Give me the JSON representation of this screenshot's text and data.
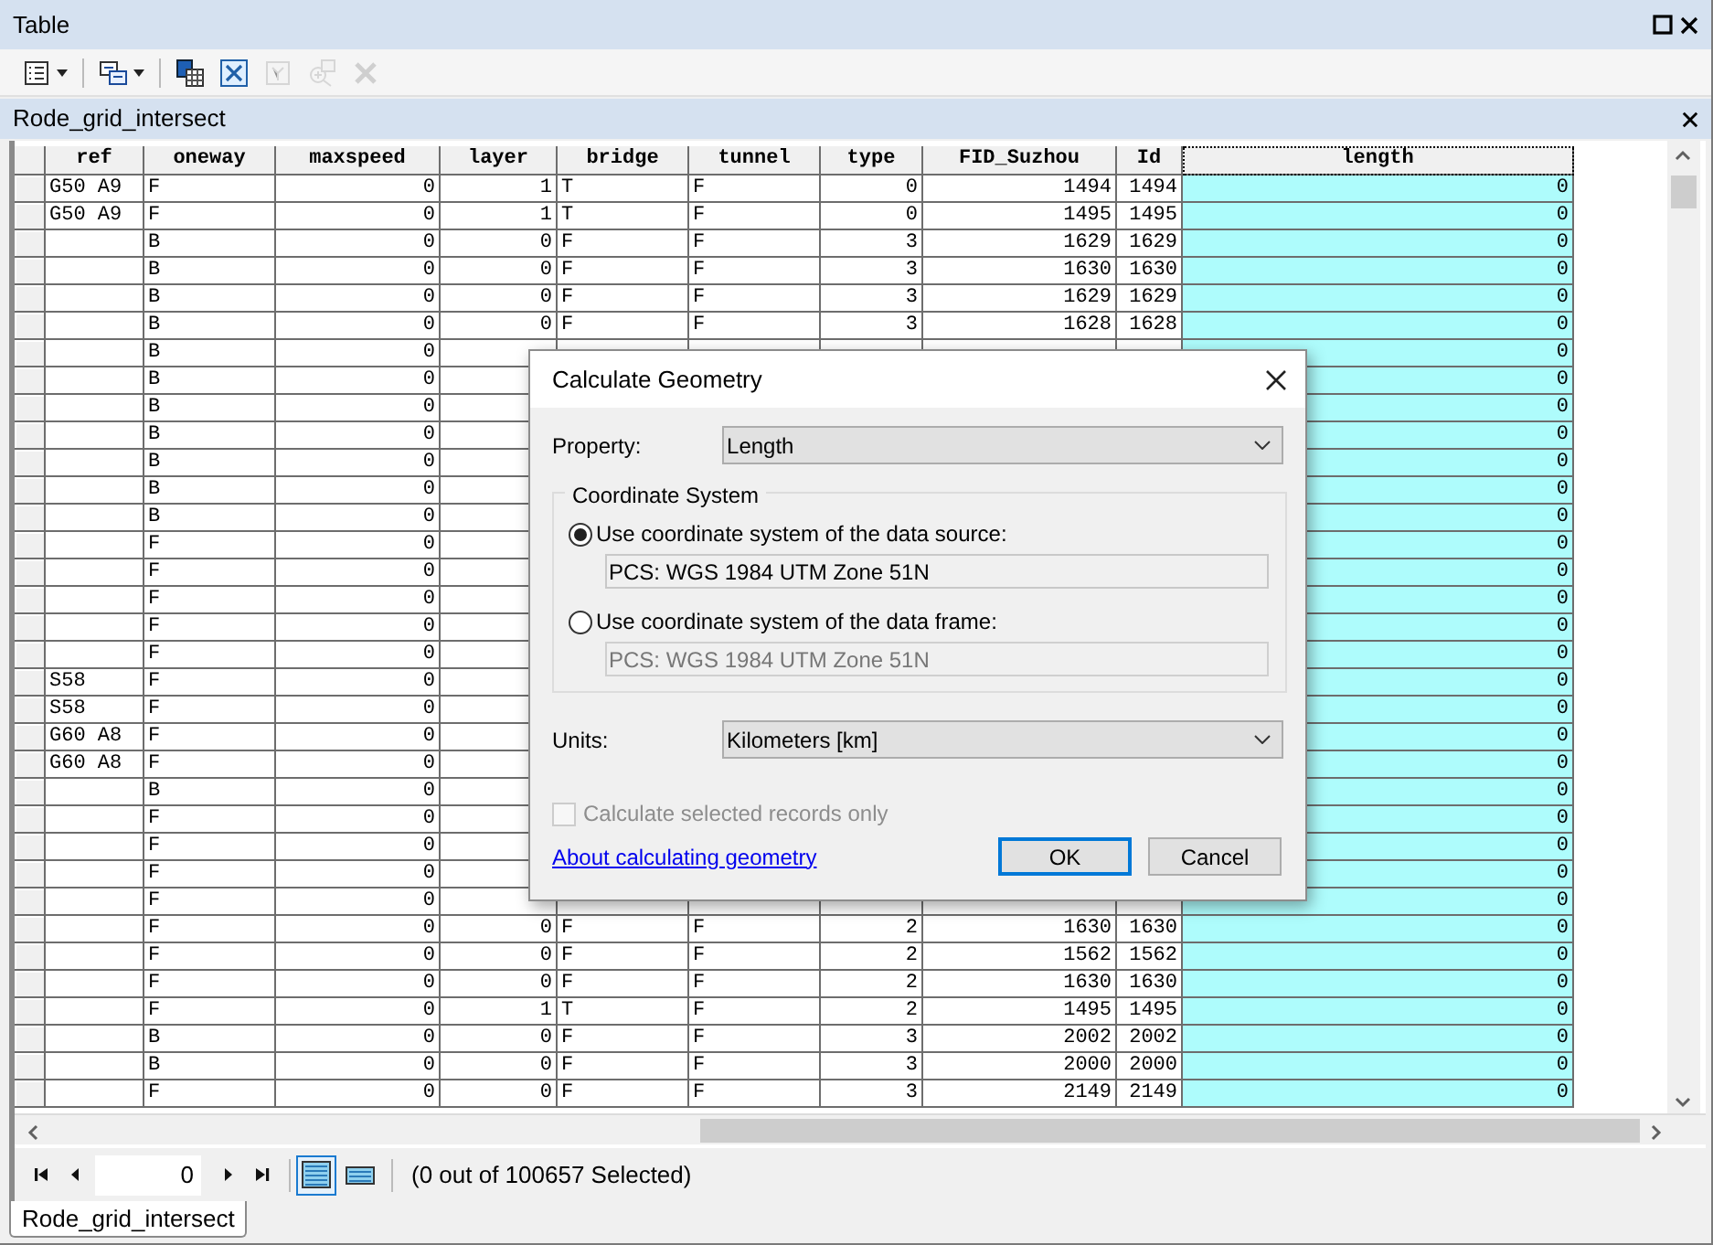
{
  "window": {
    "title": "Table"
  },
  "toolbar": [
    {
      "disabled": false
    },
    {
      "disabled": false
    },
    {
      "disabled": false
    },
    {
      "disabled": false
    },
    {
      "disabled": true
    },
    {
      "disabled": true
    },
    {
      "disabled": true
    }
  ],
  "table_tab": {
    "title": "Rode_grid_intersect"
  },
  "table": {
    "columns": [
      {
        "label": "ref",
        "selected": false
      },
      {
        "label": "oneway",
        "selected": false
      },
      {
        "label": "maxspeed",
        "selected": false
      },
      {
        "label": "layer",
        "selected": false
      },
      {
        "label": "bridge",
        "selected": false
      },
      {
        "label": "tunnel",
        "selected": false
      },
      {
        "label": "type",
        "selected": false
      },
      {
        "label": "FID_Suzhou",
        "selected": false
      },
      {
        "label": "Id",
        "selected": false
      },
      {
        "label": "length",
        "selected": true
      }
    ],
    "rows": [
      {
        "cells": [
          "G50 A9",
          "F",
          "0",
          "1",
          "T",
          "F",
          "0",
          "1494",
          "1494",
          "0"
        ]
      },
      {
        "cells": [
          "G50 A9",
          "F",
          "0",
          "1",
          "T",
          "F",
          "0",
          "1495",
          "1495",
          "0"
        ]
      },
      {
        "cells": [
          null,
          "B",
          "0",
          "0",
          "F",
          "F",
          "3",
          "1629",
          "1629",
          "0"
        ]
      },
      {
        "cells": [
          null,
          "B",
          "0",
          "0",
          "F",
          "F",
          "3",
          "1630",
          "1630",
          "0"
        ]
      },
      {
        "cells": [
          null,
          "B",
          "0",
          "0",
          "F",
          "F",
          "3",
          "1629",
          "1629",
          "0"
        ]
      },
      {
        "cells": [
          null,
          "B",
          "0",
          "0",
          "F",
          "F",
          "3",
          "1628",
          "1628",
          "0"
        ]
      },
      {
        "cells": [
          null,
          "B",
          "0",
          null,
          null,
          null,
          null,
          null,
          null,
          "0"
        ]
      },
      {
        "cells": [
          null,
          "B",
          "0",
          null,
          null,
          null,
          null,
          null,
          null,
          "0"
        ]
      },
      {
        "cells": [
          null,
          "B",
          "0",
          null,
          null,
          null,
          null,
          null,
          null,
          "0"
        ]
      },
      {
        "cells": [
          null,
          "B",
          "0",
          null,
          null,
          null,
          null,
          null,
          null,
          "0"
        ]
      },
      {
        "cells": [
          null,
          "B",
          "0",
          null,
          null,
          null,
          null,
          null,
          null,
          "0"
        ]
      },
      {
        "cells": [
          null,
          "B",
          "0",
          null,
          null,
          null,
          null,
          null,
          null,
          "0"
        ]
      },
      {
        "cells": [
          null,
          "B",
          "0",
          null,
          null,
          null,
          null,
          null,
          null,
          "0"
        ]
      },
      {
        "cells": [
          null,
          "F",
          "0",
          null,
          null,
          null,
          null,
          null,
          null,
          "0"
        ]
      },
      {
        "cells": [
          null,
          "F",
          "0",
          null,
          null,
          null,
          null,
          null,
          null,
          "0"
        ]
      },
      {
        "cells": [
          null,
          "F",
          "0",
          null,
          null,
          null,
          null,
          null,
          null,
          "0"
        ]
      },
      {
        "cells": [
          null,
          "F",
          "0",
          null,
          null,
          null,
          null,
          null,
          null,
          "0"
        ]
      },
      {
        "cells": [
          null,
          "F",
          "0",
          null,
          null,
          null,
          null,
          null,
          null,
          "0"
        ]
      },
      {
        "cells": [
          "S58",
          "F",
          "0",
          null,
          null,
          null,
          null,
          null,
          null,
          "0"
        ]
      },
      {
        "cells": [
          "S58",
          "F",
          "0",
          null,
          null,
          null,
          null,
          null,
          null,
          "0"
        ]
      },
      {
        "cells": [
          "G60 A8",
          "F",
          "0",
          null,
          null,
          null,
          null,
          null,
          null,
          "0"
        ]
      },
      {
        "cells": [
          "G60 A8",
          "F",
          "0",
          null,
          null,
          null,
          null,
          null,
          null,
          "0"
        ]
      },
      {
        "cells": [
          null,
          "B",
          "0",
          null,
          null,
          null,
          null,
          null,
          null,
          "0"
        ]
      },
      {
        "cells": [
          null,
          "F",
          "0",
          null,
          null,
          null,
          null,
          null,
          null,
          "0"
        ]
      },
      {
        "cells": [
          null,
          "F",
          "0",
          null,
          null,
          null,
          null,
          null,
          null,
          "0"
        ]
      },
      {
        "cells": [
          null,
          "F",
          "0",
          null,
          null,
          null,
          null,
          null,
          null,
          "0"
        ]
      },
      {
        "cells": [
          null,
          "F",
          "0",
          null,
          null,
          null,
          null,
          null,
          null,
          "0"
        ]
      },
      {
        "cells": [
          null,
          "F",
          "0",
          "0",
          "F",
          "F",
          "2",
          "1630",
          "1630",
          "0"
        ]
      },
      {
        "cells": [
          null,
          "F",
          "0",
          "0",
          "F",
          "F",
          "2",
          "1562",
          "1562",
          "0"
        ]
      },
      {
        "cells": [
          null,
          "F",
          "0",
          "0",
          "F",
          "F",
          "2",
          "1630",
          "1630",
          "0"
        ]
      },
      {
        "cells": [
          null,
          "F",
          "0",
          "1",
          "T",
          "F",
          "2",
          "1495",
          "1495",
          "0"
        ]
      },
      {
        "cells": [
          null,
          "B",
          "0",
          "0",
          "F",
          "F",
          "3",
          "2002",
          "2002",
          "0"
        ]
      },
      {
        "cells": [
          null,
          "B",
          "0",
          "0",
          "F",
          "F",
          "3",
          "2000",
          "2000",
          "0"
        ]
      },
      {
        "cells": [
          null,
          "F",
          "0",
          "0",
          "F",
          "F",
          "3",
          "2149",
          "2149",
          "0"
        ]
      }
    ]
  },
  "navigation": {
    "record": "0",
    "view_buttons": [
      {
        "selected": true
      },
      {
        "selected": false
      }
    ],
    "selection_status": "(0 out of 100657 Selected)"
  },
  "bottom_tabs": [
    {
      "label": "Rode_grid_intersect",
      "selected": true
    }
  ],
  "dialog": {
    "title": "Calculate Geometry",
    "property_label": "Property:",
    "property_value": "Length",
    "group_title": "Coordinate System",
    "options": [
      {
        "label": "Use coordinate system of the data source:",
        "selected": true,
        "value": "PCS: WGS 1984 UTM Zone 51N"
      },
      {
        "label": "Use coordinate system of the data frame:",
        "selected": false,
        "value": "PCS: WGS 1984 UTM Zone 51N"
      }
    ],
    "units_label": "Units:",
    "units_value": "Kilometers [km]",
    "checkbox": {
      "label": "Calculate selected records only",
      "checked": false,
      "disabled": true
    },
    "link": "About calculating geometry",
    "buttons": [
      {
        "label": "OK",
        "default": true
      },
      {
        "label": "Cancel",
        "default": false
      }
    ]
  }
}
